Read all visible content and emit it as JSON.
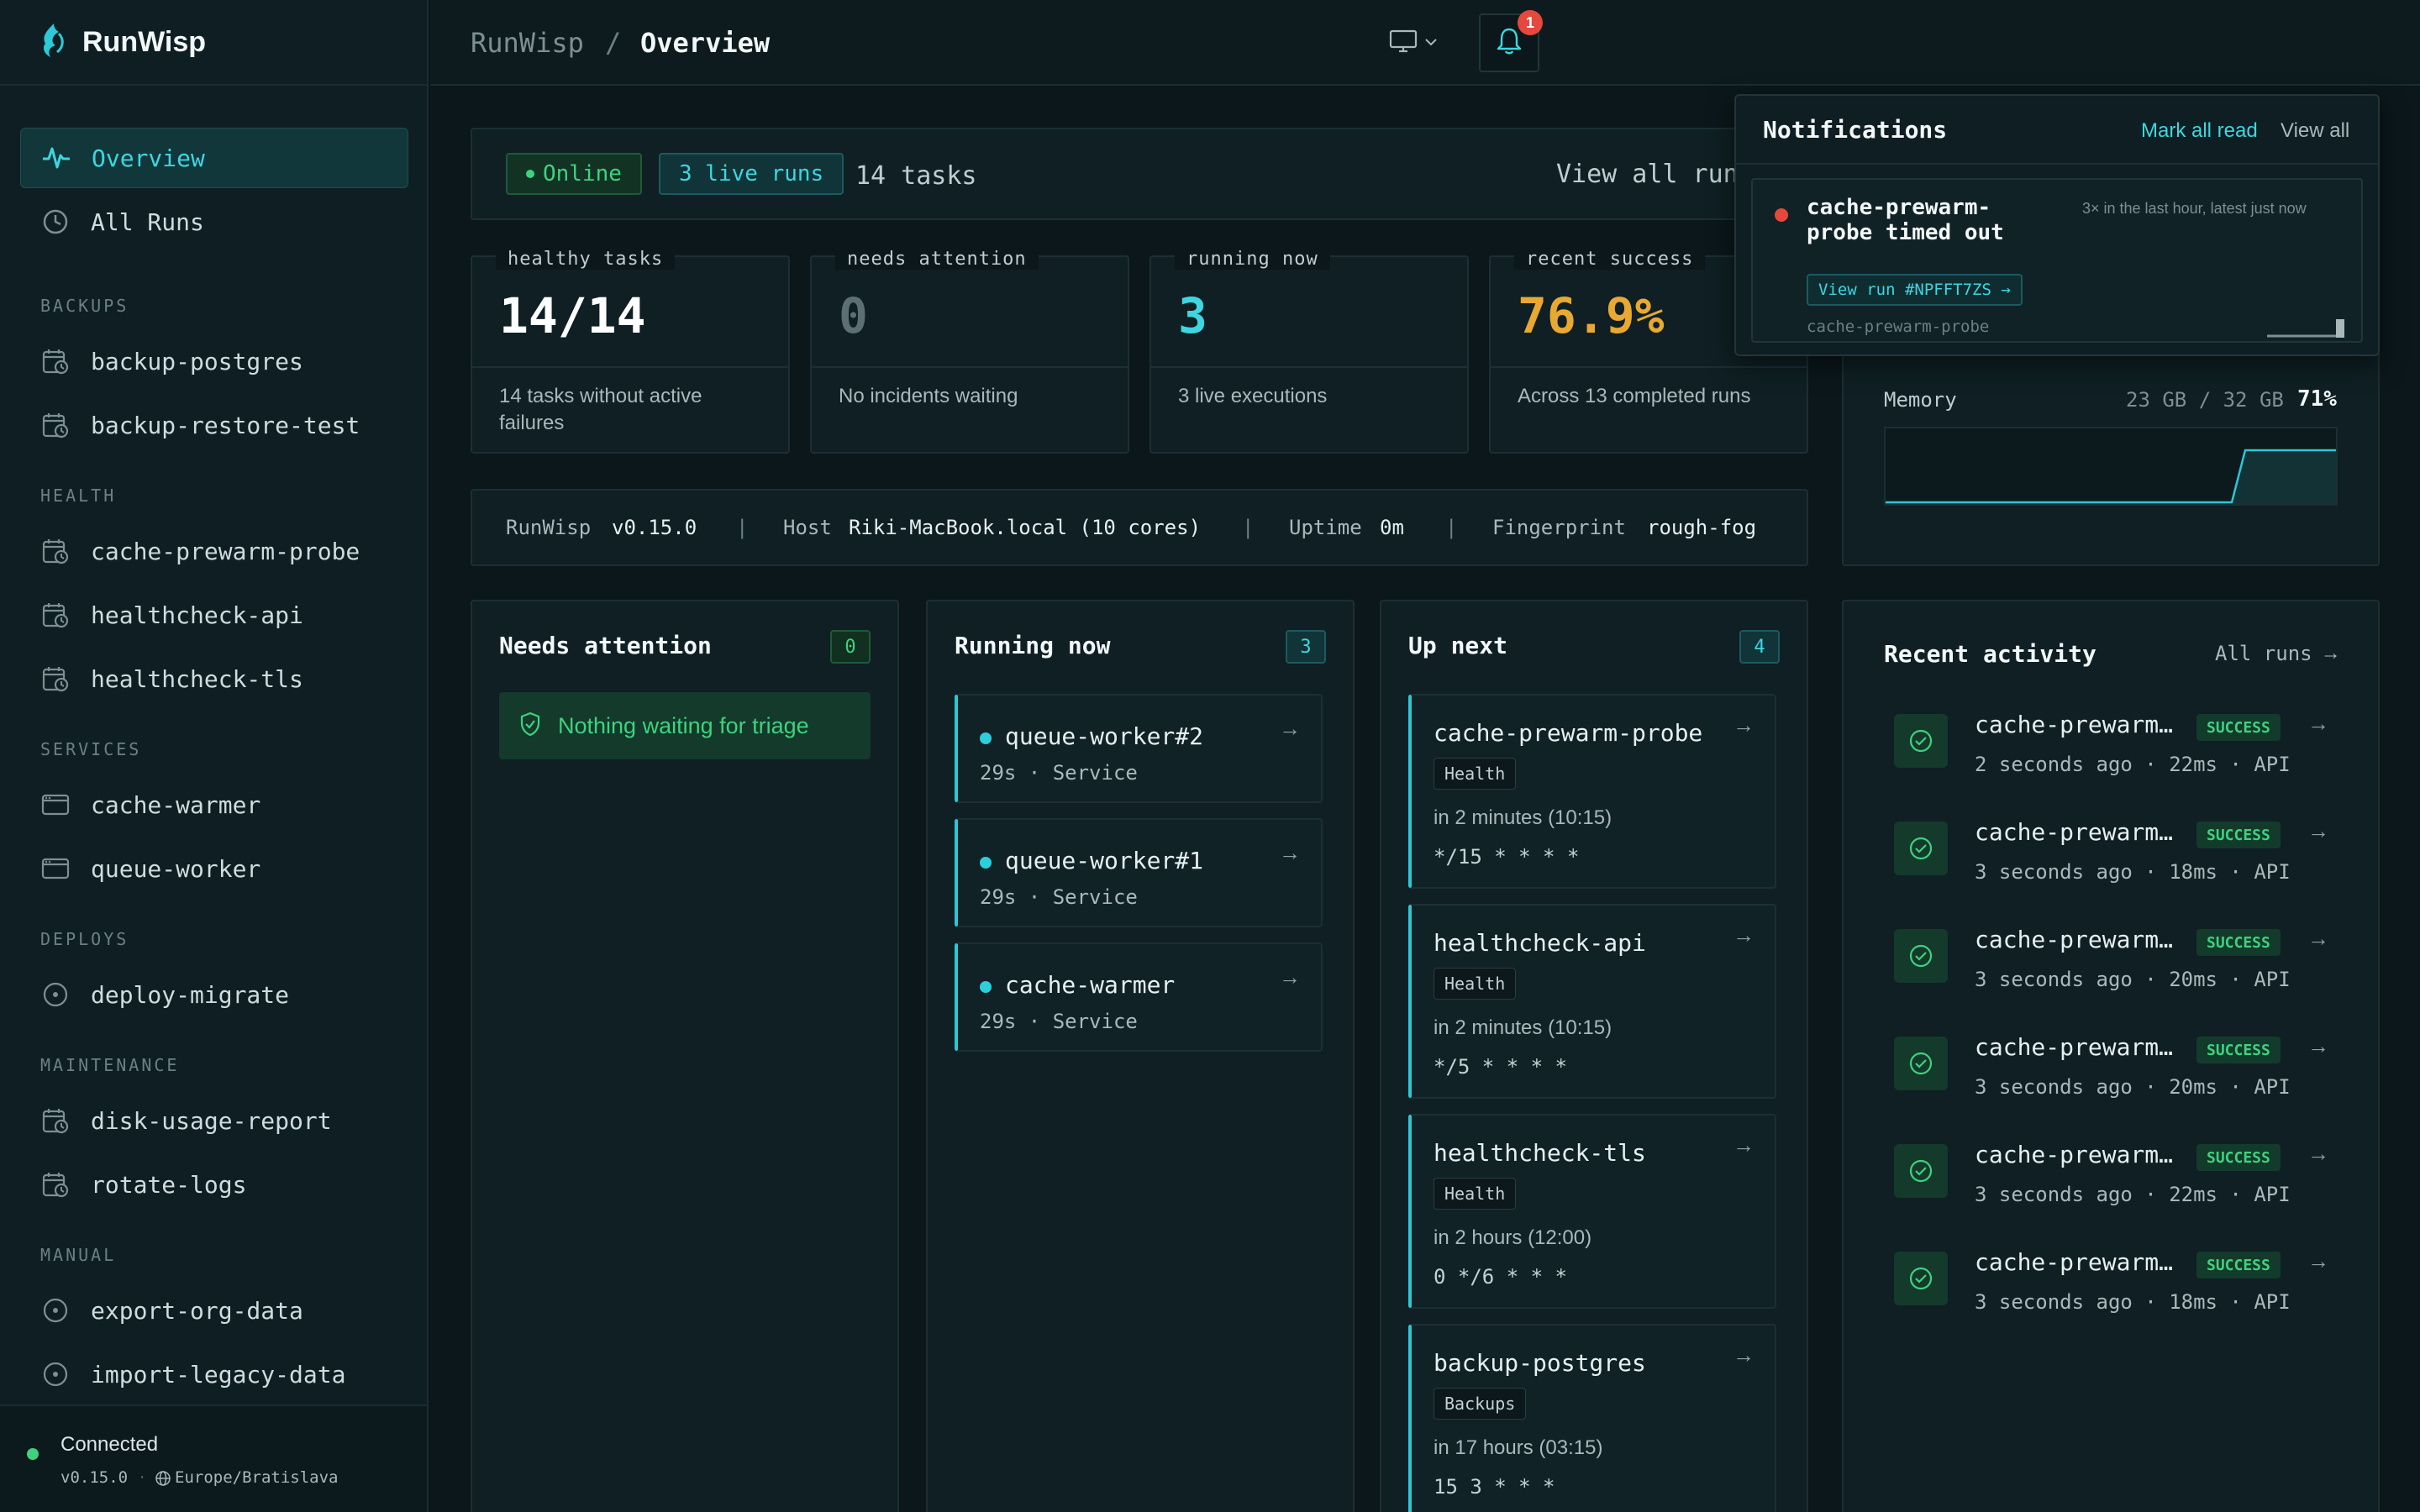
{
  "app": {
    "name": "RunWisp"
  },
  "breadcrumb": {
    "root": "RunWisp",
    "separator": "/",
    "current": "Overview"
  },
  "header": {
    "notification_count": "1"
  },
  "sidebar": {
    "primary": [
      {
        "label": "Overview",
        "icon": "activity-icon"
      },
      {
        "label": "All Runs",
        "icon": "history-icon"
      }
    ],
    "sections": [
      {
        "title": "BACKUPS",
        "items": [
          "backup-postgres",
          "backup-restore-test"
        ]
      },
      {
        "title": "HEALTH",
        "items": [
          "cache-prewarm-probe",
          "healthcheck-api",
          "healthcheck-tls"
        ]
      },
      {
        "title": "SERVICES",
        "items": [
          "cache-warmer",
          "queue-worker"
        ]
      },
      {
        "title": "DEPLOYS",
        "items": [
          "deploy-migrate"
        ]
      },
      {
        "title": "MAINTENANCE",
        "items": [
          "disk-usage-report",
          "rotate-logs"
        ]
      },
      {
        "title": "MANUAL",
        "items": [
          "export-org-data",
          "import-legacy-data"
        ]
      }
    ],
    "footer": {
      "status": "Connected",
      "version": "v0.15.0",
      "sep": "·",
      "timezone": "Europe/Bratislava"
    }
  },
  "status_bar": {
    "online": "Online",
    "live_runs": "3 live runs",
    "tasks": "14 tasks",
    "view_all": "View all runs"
  },
  "stats": [
    {
      "label": "healthy tasks",
      "value": "14/14",
      "desc": "14 tasks without active failures",
      "color": "#ffffff"
    },
    {
      "label": "needs attention",
      "value": "0",
      "desc": "No incidents waiting",
      "color": "#5d6f73"
    },
    {
      "label": "running now",
      "value": "3",
      "desc": "3 live executions",
      "color": "#3ed6e0"
    },
    {
      "label": "recent success",
      "value": "76.9%",
      "desc": "Across 13 completed runs",
      "color": "#e8a832"
    }
  ],
  "info_bar": {
    "app_label": "RunWisp",
    "version": "v0.15.0",
    "host_label": "Host",
    "host": "Riki-MacBook.local (10 cores)",
    "uptime_label": "Uptime",
    "uptime": "0m",
    "fingerprint_label": "Fingerprint",
    "fingerprint": "rough-fog",
    "divider": "|"
  },
  "memory": {
    "label": "Memory",
    "used": "23 GB / 32 GB",
    "percent": "71%",
    "percent_value": 71
  },
  "needs_attention": {
    "title": "Needs attention",
    "count": "0",
    "empty": "Nothing waiting for triage"
  },
  "running_now": {
    "title": "Running now",
    "count": "3",
    "items": [
      {
        "name": "queue-worker#2",
        "meta": "29s · Service"
      },
      {
        "name": "queue-worker#1",
        "meta": "29s · Service"
      },
      {
        "name": "cache-warmer",
        "meta": "29s · Service"
      }
    ]
  },
  "up_next": {
    "title": "Up next",
    "count": "4",
    "items": [
      {
        "name": "cache-prewarm-probe",
        "tag": "Health",
        "when": "in 2 minutes (10:15)",
        "cron": "*/15 * * * *"
      },
      {
        "name": "healthcheck-api",
        "tag": "Health",
        "when": "in 2 minutes (10:15)",
        "cron": "*/5 * * * *"
      },
      {
        "name": "healthcheck-tls",
        "tag": "Health",
        "when": "in 2 hours (12:00)",
        "cron": "0 */6 * * *"
      },
      {
        "name": "backup-postgres",
        "tag": "Backups",
        "when": "in 17 hours (03:15)",
        "cron": "15 3 * * *"
      }
    ]
  },
  "recent_activity": {
    "title": "Recent activity",
    "all_runs": "All runs",
    "items": [
      {
        "name": "cache-prewarm-probe",
        "status": "SUCCESS",
        "meta": "2 seconds ago · 22ms · API"
      },
      {
        "name": "cache-prewarm-probe",
        "status": "SUCCESS",
        "meta": "3 seconds ago · 18ms · API"
      },
      {
        "name": "cache-prewarm-probe",
        "status": "SUCCESS",
        "meta": "3 seconds ago · 20ms · API"
      },
      {
        "name": "cache-prewarm-probe",
        "status": "SUCCESS",
        "meta": "3 seconds ago · 20ms · API"
      },
      {
        "name": "cache-prewarm-probe",
        "status": "SUCCESS",
        "meta": "3 seconds ago · 22ms · API"
      },
      {
        "name": "cache-prewarm-probe",
        "status": "SUCCESS",
        "meta": "3 seconds ago · 18ms · API"
      }
    ]
  },
  "notifications": {
    "title": "Notifications",
    "mark_all_read": "Mark all read",
    "view_all": "View all",
    "items": [
      {
        "title": "cache-prewarm-probe timed out",
        "meta": "3× in the last hour, latest just now",
        "action": "View run #NPFFT7ZS →",
        "task": "cache-prewarm-probe"
      }
    ]
  }
}
